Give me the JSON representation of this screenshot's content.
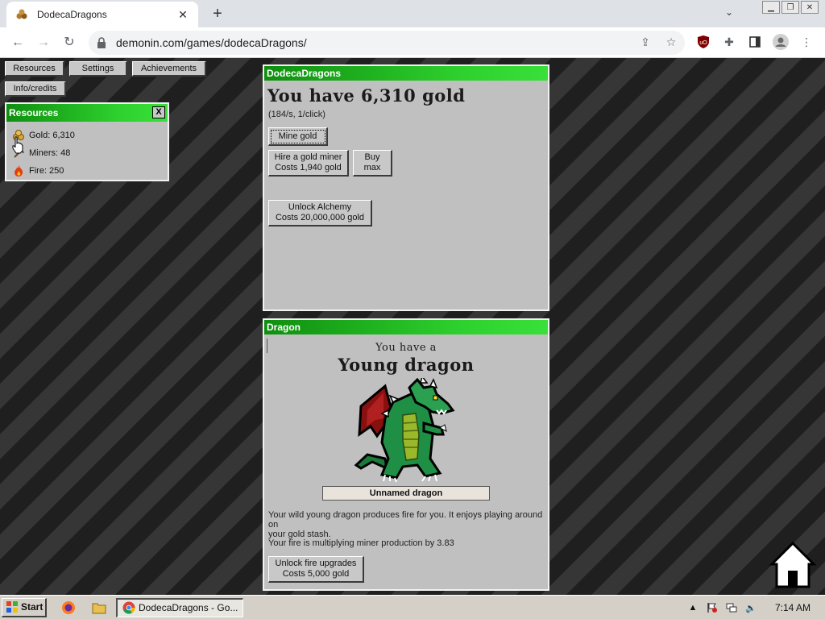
{
  "browser": {
    "tab_title": "DodecaDragons",
    "url": "demonin.com/games/dodecaDragons/"
  },
  "nav": {
    "resources_label": "Resources",
    "settings_label": "Settings",
    "achievements_label": "Achievements",
    "info_label": "Info/credits"
  },
  "resources": {
    "title": "Resources",
    "close_label": "X",
    "gold": "Gold: 6,310",
    "miners": "Miners: 48",
    "fire": "Fire: 250"
  },
  "main": {
    "title": "DodecaDragons",
    "gold_text": "You have 6,310 gold",
    "rate_text": "(184/s, 1/click)",
    "mine_label": "Mine gold",
    "hire_line1": "Hire a gold miner",
    "hire_line2": "Costs 1,940 gold",
    "buymax_line1": "Buy",
    "buymax_line2": "max",
    "alchemy_line1": "Unlock Alchemy",
    "alchemy_line2": "Costs 20,000,000 gold"
  },
  "dragon": {
    "title": "Dragon",
    "you_have": "You have a",
    "stage": "Young dragon",
    "name": "Unnamed dragon",
    "desc_line1": "Your wild young dragon produces fire for you. It enjoys playing around on",
    "desc_line2": "your gold stash.",
    "multiplier": "Your fire is multiplying miner production by 3.83",
    "upgrade_line1": "Unlock fire upgrades",
    "upgrade_line2": "Costs 5,000 gold"
  },
  "taskbar": {
    "start_label": "Start",
    "task_label": "DodecaDragons - Go...",
    "time": "7:14 AM"
  }
}
